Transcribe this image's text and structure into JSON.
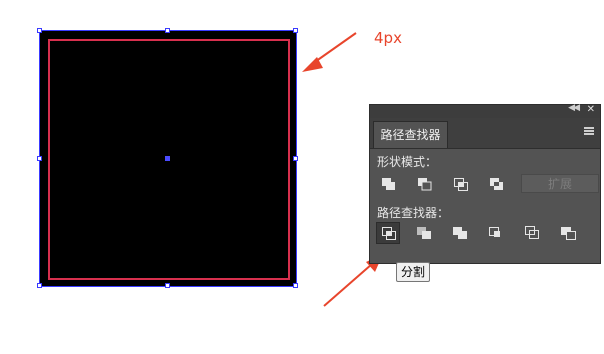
{
  "annotation": {
    "stroke_width": "4px"
  },
  "colors": {
    "artwork_fill": "#000000",
    "stroke": "#d8304e",
    "selection": "#3a3aff",
    "arrow": "#e8452c",
    "panel_bg": "#535353"
  },
  "panel": {
    "tab": "路径查找器",
    "shape_modes_label": "形状模式：",
    "expand_label": "扩展",
    "pathfinders_label": "路径查找器：",
    "shape_mode_icons": [
      "unite-icon",
      "minus-front-icon",
      "intersect-icon",
      "exclude-icon"
    ],
    "pathfinder_icons": [
      "divide-icon",
      "trim-icon",
      "merge-icon",
      "crop-icon",
      "outline-icon",
      "minus-back-icon"
    ]
  },
  "tooltip": {
    "text": "分割"
  }
}
